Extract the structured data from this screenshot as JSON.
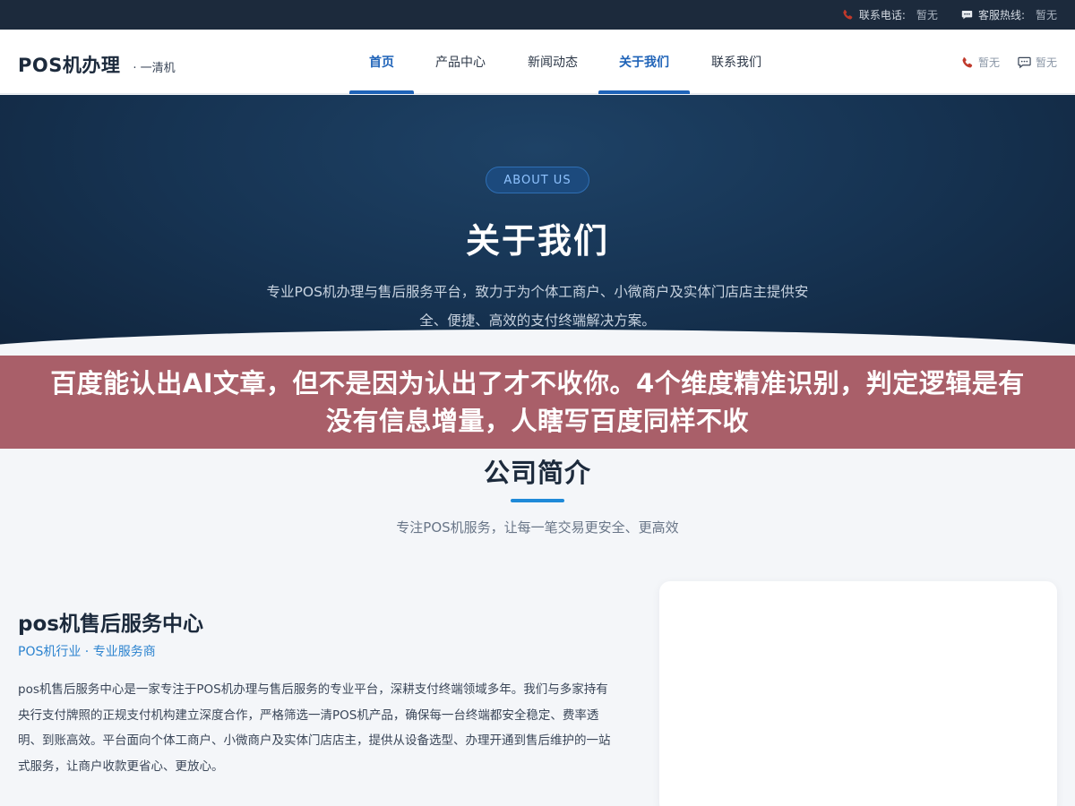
{
  "topbar": {
    "phone_label": "联系电话:",
    "phone_value": "暂无",
    "hotline_label": "客服热线:",
    "hotline_value": "暂无"
  },
  "header": {
    "logo": "POS机办理",
    "logo_sub": "· 一清机",
    "nav": [
      {
        "label": "首页",
        "active": true
      },
      {
        "label": "产品中心",
        "active": false
      },
      {
        "label": "新闻动态",
        "active": false
      },
      {
        "label": "关于我们",
        "active": true
      },
      {
        "label": "联系我们",
        "active": false
      }
    ],
    "phone_value": "暂无",
    "chat_value": "暂无"
  },
  "hero": {
    "badge": "ABOUT US",
    "title": "关于我们",
    "description": "专业POS机办理与售后服务平台，致力于为个体工商户、小微商户及实体门店店主提供安全、便捷、高效的支付终端解决方案。"
  },
  "overlay": {
    "text": "百度能认出AI文章，但不是因为认出了才不收你。4个维度精准识别，判定逻辑是有没有信息增量，人瞎写百度同样不收"
  },
  "section": {
    "title": "公司简介",
    "subtitle": "专注POS机服务，让每一笔交易更安全、更高效"
  },
  "company": {
    "name": "pos机售后服务中心",
    "tag": "POS机行业 · 专业服务商",
    "description": "pos机售后服务中心是一家专注于POS机办理与售后服务的专业平台，深耕支付终端领域多年。我们与多家持有央行支付牌照的正规支付机构建立深度合作，严格筛选一清POS机产品，确保每一台终端都安全稳定、费率透明、到账高效。平台面向个体工商户、小微商户及实体门店店主，提供从设备选型、办理开通到售后维护的一站式服务，让商户收款更省心、更放心。"
  },
  "colors": {
    "topbar_bg": "#1c2a3c",
    "accent": "#1f63b8",
    "overlay_bg": "#a65a64",
    "phone_icon": "#c0392b"
  }
}
